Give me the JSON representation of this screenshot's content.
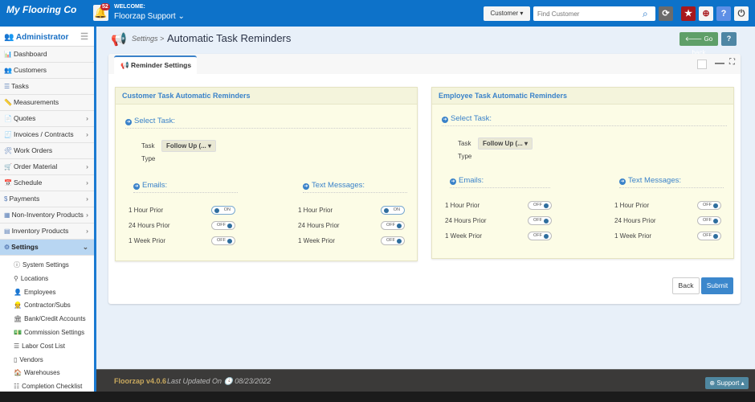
{
  "topbar": {
    "brand": "My Flooring Co",
    "notifications": "52",
    "welcome": "WELCOME:",
    "user": "Floorzap Support ⌄",
    "customer_select": "Customer ▾",
    "search_placeholder": "Find Customer",
    "colors": {
      "bar": "#0d72c9"
    }
  },
  "sidebar": {
    "title": "Administrator",
    "items": [
      {
        "label": "Dashboard",
        "icon": "chart-icon",
        "chev": false
      },
      {
        "label": "Customers",
        "icon": "users-icon",
        "chev": false
      },
      {
        "label": "Tasks",
        "icon": "list-icon",
        "chev": false
      },
      {
        "label": "Measurements",
        "icon": "ruler-icon",
        "chev": false
      },
      {
        "label": "Quotes",
        "icon": "file-icon",
        "chev": true
      },
      {
        "label": "Invoices / Contracts",
        "icon": "invoice-icon",
        "chev": true
      },
      {
        "label": "Work Orders",
        "icon": "tools-icon",
        "chev": false
      },
      {
        "label": "Order Material",
        "icon": "cart-icon",
        "chev": true
      },
      {
        "label": "Schedule",
        "icon": "calendar-icon",
        "chev": true
      },
      {
        "label": "Payments",
        "icon": "dollar-icon",
        "chev": true
      },
      {
        "label": "Non-Inventory Products",
        "icon": "box-icon",
        "chev": true
      },
      {
        "label": "Inventory Products",
        "icon": "boxes-icon",
        "chev": true
      },
      {
        "label": "Settings",
        "icon": "gear-icon",
        "chev": true,
        "active": true
      }
    ],
    "subitems": [
      {
        "label": "System Settings",
        "icon": "info-icon"
      },
      {
        "label": "Locations",
        "icon": "pin-icon"
      },
      {
        "label": "Employees",
        "icon": "user-icon"
      },
      {
        "label": "Contractor/Subs",
        "icon": "worker-icon"
      },
      {
        "label": "Bank/Credit Accounts",
        "icon": "bank-icon"
      },
      {
        "label": "Commission Settings",
        "icon": "money-icon"
      },
      {
        "label": "Labor Cost List",
        "icon": "list-icon"
      },
      {
        "label": "Vendors",
        "icon": "vendor-icon"
      },
      {
        "label": "Warehouses",
        "icon": "warehouse-icon"
      },
      {
        "label": "Completion Checklist",
        "icon": "checklist-icon"
      }
    ]
  },
  "header": {
    "breadcrumb": "Settings >",
    "title": "Automatic Task Reminders",
    "go_back": "🡐 Go back",
    "help": "?"
  },
  "panel": {
    "tab": "Reminder Settings",
    "back": "Back",
    "submit": "Submit"
  },
  "cards": [
    {
      "title": "Customer Task Automatic Reminders",
      "select_task": "Select Task:",
      "task_label": "Task",
      "type_label": "Type",
      "task_value": "Follow Up (...  ▾",
      "emails": "Emails:",
      "texts": "Text Messages:",
      "email_rows": [
        {
          "label": "1 Hour Prior",
          "on": true
        },
        {
          "label": "24 Hours Prior",
          "on": false
        },
        {
          "label": "1 Week Prior",
          "on": false
        }
      ],
      "text_rows": [
        {
          "label": "1 Hour Prior",
          "on": true
        },
        {
          "label": "24 Hours Prior",
          "on": false
        },
        {
          "label": "1 Week Prior",
          "on": false
        }
      ]
    },
    {
      "title": "Employee Task Automatic Reminders",
      "select_task": "Select Task:",
      "task_label": "Task",
      "type_label": "Type",
      "task_value": "Follow Up (...  ▾",
      "emails": "Emails:",
      "texts": "Text Messages:",
      "email_rows": [
        {
          "label": "1 Hour Prior",
          "on": false
        },
        {
          "label": "24 Hours Prior",
          "on": false
        },
        {
          "label": "1 Week Prior",
          "on": false
        }
      ],
      "text_rows": [
        {
          "label": "1 Hour Prior",
          "on": false
        },
        {
          "label": "24 Hours Prior",
          "on": false
        },
        {
          "label": "1 Week Prior",
          "on": false
        }
      ]
    }
  ],
  "toggle_text": {
    "on": "ON",
    "off": "OFF"
  },
  "footer": {
    "version": "Floorzap v4.0.6",
    "updated": "Last Updated On  🕓 08/23/2022",
    "support": "⊕ Support ▴"
  }
}
